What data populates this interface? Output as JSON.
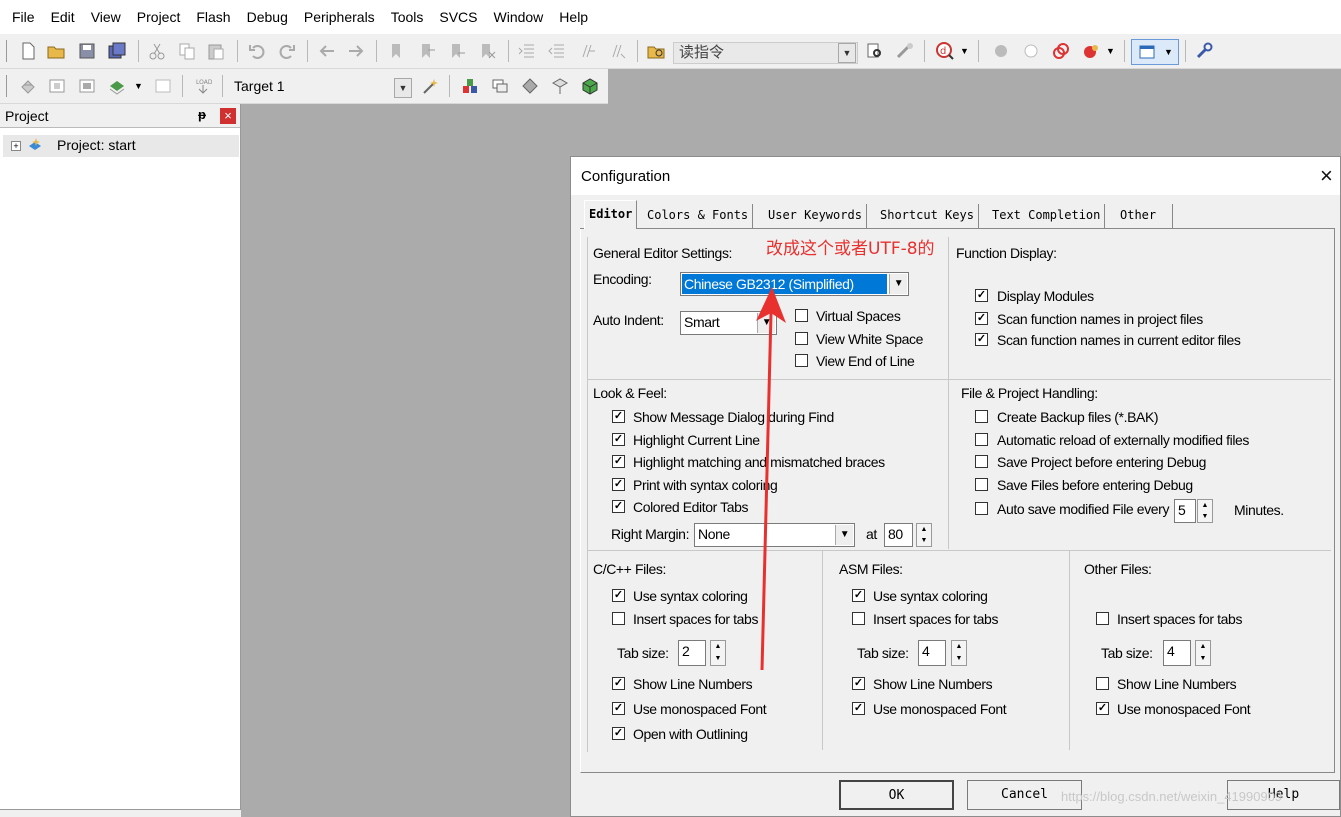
{
  "menu": [
    "File",
    "Edit",
    "View",
    "Project",
    "Flash",
    "Debug",
    "Peripherals",
    "Tools",
    "SVCS",
    "Window",
    "Help"
  ],
  "toolbar": {
    "find_combo": "读指令",
    "target": "Target 1"
  },
  "project_pane": {
    "title": "Project",
    "pin": "ᵽ",
    "close": "×",
    "root": "Project: start"
  },
  "dialog": {
    "title": "Configuration",
    "close": "×",
    "tabs": [
      "Editor",
      "Colors & Fonts",
      "User Keywords",
      "Shortcut Keys",
      "Text Completion",
      "Other"
    ],
    "general": {
      "title": "General Editor Settings:",
      "encoding_label": "Encoding:",
      "encoding_value": "Chinese GB2312 (Simplified)",
      "auto_indent_label": "Auto Indent:",
      "auto_indent_value": "Smart",
      "virtual_spaces": "Virtual Spaces",
      "view_white_space": "View White Space",
      "view_end_of_line": "View End of Line"
    },
    "annotation": "改成这个或者UTF-8的",
    "function_display": {
      "title": "Function Display:",
      "items": [
        "Display Modules",
        "Scan function names in project files",
        "Scan function names in current editor files"
      ]
    },
    "look_feel": {
      "title": "Look & Feel:",
      "items": [
        "Show Message Dialog during Find",
        "Highlight Current Line",
        "Highlight matching and mismatched braces",
        "Print with syntax coloring",
        "Colored Editor Tabs"
      ],
      "right_margin_label": "Right Margin:",
      "right_margin_value": "None",
      "at_label": "at",
      "at_value": "80"
    },
    "file_project": {
      "title": "File & Project Handling:",
      "items": [
        "Create Backup files (*.BAK)",
        "Automatic reload of externally modified files",
        "Save Project before entering Debug",
        "Save Files before entering Debug",
        "Auto save modified File every"
      ],
      "autosave_value": "5",
      "minutes": "Minutes."
    },
    "cpp": {
      "title": "C/C++ Files:",
      "syntax": "Use syntax coloring",
      "insert_spaces": "Insert spaces for tabs",
      "tab_size_label": "Tab size:",
      "tab_size": "2",
      "line_numbers": "Show Line Numbers",
      "monospaced": "Use monospaced Font",
      "outlining": "Open with Outlining"
    },
    "asm": {
      "title": "ASM Files:",
      "syntax": "Use syntax coloring",
      "insert_spaces": "Insert spaces for tabs",
      "tab_size_label": "Tab size:",
      "tab_size": "4",
      "line_numbers": "Show Line Numbers",
      "monospaced": "Use monospaced Font"
    },
    "other": {
      "title": "Other Files:",
      "insert_spaces": "Insert spaces for tabs",
      "tab_size_label": "Tab size:",
      "tab_size": "4",
      "line_numbers": "Show Line Numbers",
      "monospaced": "Use monospaced Font"
    },
    "buttons": {
      "ok": "OK",
      "cancel": "Cancel",
      "help": "Help"
    },
    "watermark": "https://blog.csdn.net/weixin_41990909"
  },
  "colors": {
    "annotation": "#e8312f",
    "selection": "#0078d7",
    "close_red": "#d03030"
  }
}
